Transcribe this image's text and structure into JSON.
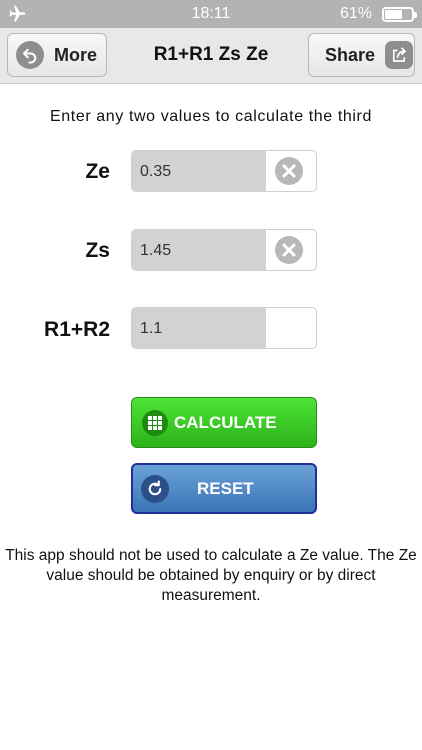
{
  "status_bar": {
    "time": "18:11",
    "battery_percent": "61%",
    "battery_level": 0.61
  },
  "nav": {
    "more_label": "More",
    "title": "R1+R1 Zs Ze",
    "share_label": "Share"
  },
  "instruction": "Enter any two values to calculate the third",
  "fields": [
    {
      "label": "Ze",
      "value": "0.35",
      "has_clear": true
    },
    {
      "label": "Zs",
      "value": "1.45",
      "has_clear": true
    },
    {
      "label": "R1+R2",
      "value": "1.1",
      "has_clear": false
    }
  ],
  "buttons": {
    "calculate": "CALCULATE",
    "reset": "RESET"
  },
  "disclaimer": "This app should not be used to calculate a Ze value. The Ze value should be obtained by enquiry or by direct measurement.",
  "colors": {
    "calculate_green": "#2cb31a",
    "reset_blue": "#3a74b6",
    "status_gray": "#b3b3b3"
  }
}
